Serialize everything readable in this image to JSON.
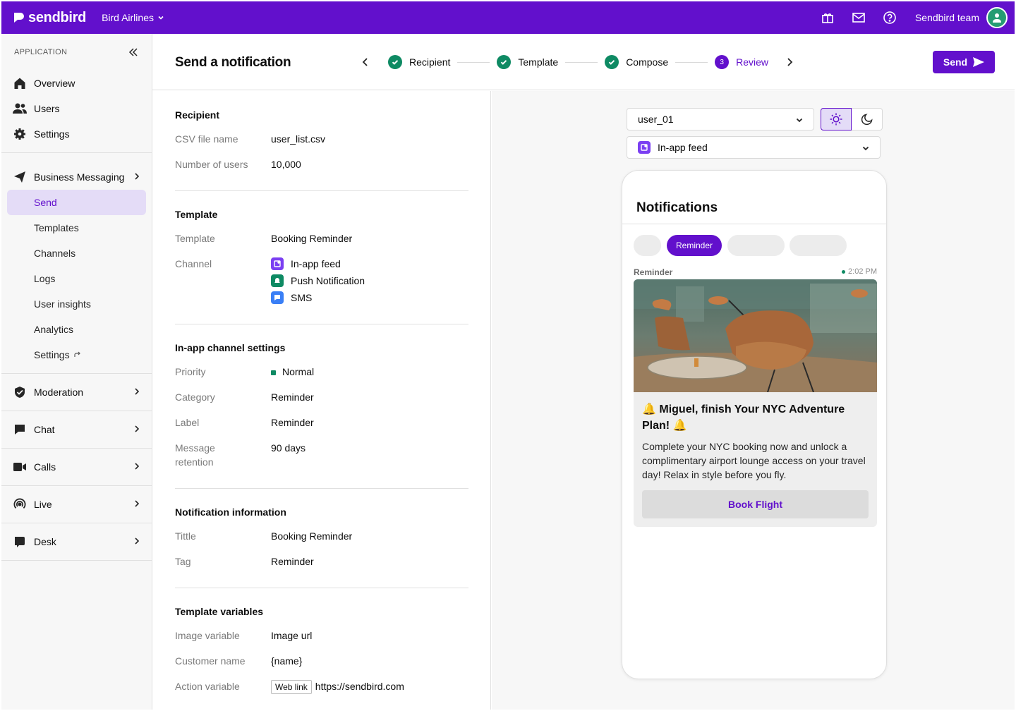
{
  "topbar": {
    "brand": "sendbird",
    "org_name": "Bird Airlines",
    "team_name": "Sendbird team",
    "icons": [
      "gift-icon",
      "mail-icon",
      "help-icon",
      "user-icon"
    ],
    "bg_color": "#6210cc"
  },
  "sidebar": {
    "section_label": "APPLICATION",
    "top_items": [
      {
        "label": "Overview",
        "icon": "home-icon"
      },
      {
        "label": "Users",
        "icon": "users-icon"
      },
      {
        "label": "Settings",
        "icon": "gear-icon"
      }
    ],
    "business_messaging": {
      "label": "Business Messaging",
      "icon": "send-plane-icon",
      "sub_items": [
        "Send",
        "Templates",
        "Channels",
        "Logs",
        "User insights",
        "Analytics",
        "Settings"
      ],
      "active": "Send"
    },
    "groups": [
      {
        "label": "Moderation",
        "icon": "shield-icon"
      },
      {
        "label": "Chat",
        "icon": "chat-icon"
      },
      {
        "label": "Calls",
        "icon": "video-icon"
      },
      {
        "label": "Live",
        "icon": "broadcast-icon"
      },
      {
        "label": "Desk",
        "icon": "desk-icon"
      }
    ]
  },
  "header": {
    "title": "Send a notification",
    "steps": [
      {
        "label": "Recipient",
        "state": "done"
      },
      {
        "label": "Template",
        "state": "done"
      },
      {
        "label": "Compose",
        "state": "done"
      },
      {
        "label": "Review",
        "state": "current",
        "number": "3"
      }
    ],
    "send_label": "Send"
  },
  "review": {
    "recipient": {
      "heading": "Recipient",
      "csv_label": "CSV file name",
      "csv_value": "user_list.csv",
      "users_label": "Number of users",
      "users_value": "10,000"
    },
    "template": {
      "heading": "Template",
      "template_label": "Template",
      "template_value": "Booking Reminder",
      "channel_label": "Channel",
      "channels": [
        "In-app feed",
        "Push Notification",
        "SMS"
      ],
      "channel_colors": [
        "#6210cc",
        "#0e8a63",
        "#3a7ff6"
      ]
    },
    "inapp": {
      "heading": "In-app channel settings",
      "priority_label": "Priority",
      "priority_value": "Normal",
      "category_label": "Category",
      "category_value": "Reminder",
      "label_label": "Label",
      "label_value": "Reminder",
      "retention_label_1": "Message",
      "retention_label_2": "retention",
      "retention_value": "90 days"
    },
    "notification": {
      "heading": "Notification information",
      "title_label": "Tittle",
      "title_value": "Booking Reminder",
      "tag_label": "Tag",
      "tag_value": "Reminder"
    },
    "variables": {
      "heading": "Template variables",
      "image_label": "Image variable",
      "image_value": "Image url",
      "customer_label": "Customer name",
      "customer_value": "{name}",
      "action_label": "Action variable",
      "action_badge": "Web link",
      "action_value": "https://sendbird.com"
    }
  },
  "preview": {
    "user_select": "user_01",
    "channel_select": "In-app feed",
    "phone_title": "Notifications",
    "filter_active": "Reminder",
    "msg_label": "Reminder",
    "msg_time": "2:02 PM",
    "card_title": "🔔 Miguel, finish Your NYC Adventure Plan! 🔔",
    "card_body": "Complete your NYC booking now and unlock a complimentary airport lounge access on your travel day! Relax in style before you fly.",
    "card_button": "Book Flight"
  }
}
